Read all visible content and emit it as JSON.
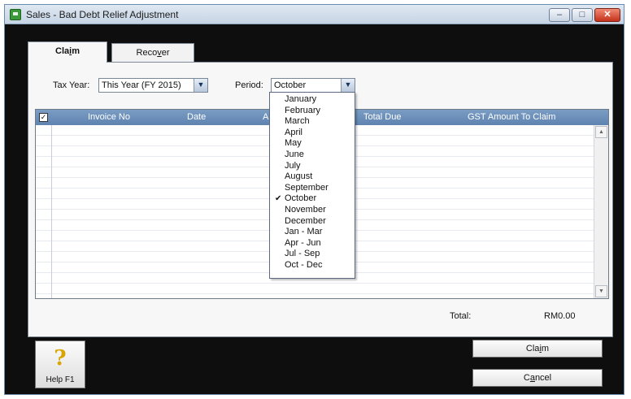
{
  "window": {
    "title": "Sales - Bad Debt Relief Adjustment",
    "controls": {
      "minimize": "–",
      "maximize": "□",
      "close": "✕"
    }
  },
  "tabs": [
    {
      "label_prefix": "Cla",
      "label_underline": "i",
      "label_suffix": "m",
      "active": true
    },
    {
      "label_prefix": "Reco",
      "label_underline": "v",
      "label_suffix": "er",
      "active": false
    }
  ],
  "filters": {
    "tax_year_label": "Tax Year:",
    "tax_year_value": "This Year (FY 2015)",
    "period_label": "Period:",
    "period_value": "October"
  },
  "grid": {
    "columns": [
      "Invoice No",
      "Date",
      "Amount",
      "Total Due",
      "GST Amount To Claim"
    ],
    "select_all_checked": true,
    "rows": []
  },
  "period_options": [
    {
      "label": "January",
      "selected": false
    },
    {
      "label": "February",
      "selected": false
    },
    {
      "label": "March",
      "selected": false
    },
    {
      "label": "April",
      "selected": false
    },
    {
      "label": "May",
      "selected": false
    },
    {
      "label": "June",
      "selected": false
    },
    {
      "label": "July",
      "selected": false
    },
    {
      "label": "August",
      "selected": false
    },
    {
      "label": "September",
      "selected": false
    },
    {
      "label": "October",
      "selected": true
    },
    {
      "label": "November",
      "selected": false
    },
    {
      "label": "December",
      "selected": false
    },
    {
      "label": "Jan - Mar",
      "selected": false
    },
    {
      "label": "Apr - Jun",
      "selected": false
    },
    {
      "label": "Jul - Sep",
      "selected": false
    },
    {
      "label": "Oct - Dec",
      "selected": false
    }
  ],
  "totals": {
    "label": "Total:",
    "value": "RM0.00"
  },
  "help_button": {
    "label": "Help F1",
    "icon": "question-icon"
  },
  "buttons": {
    "claim_prefix": "Cla",
    "claim_underline": "i",
    "claim_suffix": "m",
    "cancel_prefix": "C",
    "cancel_underline": "a",
    "cancel_suffix": "ncel"
  },
  "colors": {
    "grid_header": "#6a8fba",
    "window_background": "#0e0e0e",
    "help_icon": "#d9a400"
  }
}
